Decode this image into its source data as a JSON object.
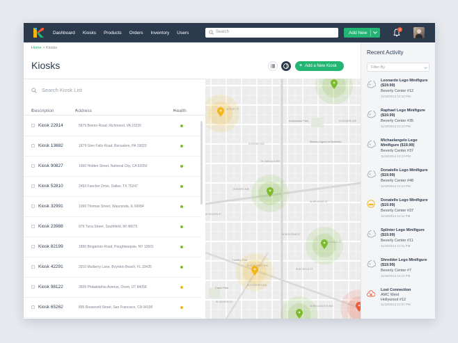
{
  "nav": {
    "items": [
      "Dashboard",
      "Kiosks",
      "Products",
      "Orders",
      "Inventory",
      "Users"
    ]
  },
  "search": {
    "placeholder": "Search"
  },
  "add_new": {
    "label": "Add New"
  },
  "notifications": {
    "count": "3"
  },
  "breadcrumb": {
    "home": "Home",
    "sep": " > ",
    "current": "Kiosks"
  },
  "page": {
    "title": "Kiosks"
  },
  "add_kiosk": {
    "label": "Add a New Kiosk",
    "icon": "+"
  },
  "kiosk_search": {
    "placeholder": "Search Kiosk List"
  },
  "table": {
    "columns": [
      "Description",
      "Address",
      "Health"
    ],
    "rows": [
      {
        "desc": "Kiosk 22914",
        "addr": "5875 Bremo Road, Richmond, VA 23226",
        "health": "#7dbb2e"
      },
      {
        "desc": "Kiosk 13682",
        "addr": "1879 Glen Falls Road, Bensalem, PA 19020",
        "health": "#7dbb2e"
      },
      {
        "desc": "Kiosk 90827",
        "addr": "1900 Holden Street, National City, CA 92050",
        "health": "#7dbb2e"
      },
      {
        "desc": "Kiosk 52810",
        "addr": "2493 Fancher Drive, Dallas, TX 75247",
        "health": "#7dbb2e"
      },
      {
        "desc": "Kiosk 32991",
        "addr": "1990 Thomas Street, Wauconda, IL 60084",
        "health": "#7dbb2e"
      },
      {
        "desc": "Kiosk 23988",
        "addr": "979 Tuna Street, Southfield, MI 48075",
        "health": "#7dbb2e"
      },
      {
        "desc": "Kiosk 82199",
        "addr": "1890 Bingamon Road, Poughkeepsie, NY 12601",
        "health": "#7dbb2e"
      },
      {
        "desc": "Kiosk 42291",
        "addr": "2910 Mulberry Lane, Boynton Beach, FL 33435",
        "health": "#7dbb2e"
      },
      {
        "desc": "Kiosk 98122",
        "addr": "3505 Philadelphia Avenue, Orem, UT 84058",
        "health": "#f2b619"
      },
      {
        "desc": "Kiosk 65262",
        "addr": "895 Roosevelt Street, San Francisco, CA 94108",
        "health": "#f2b619"
      }
    ]
  },
  "map": {
    "streets": [
      "W EDDY ST",
      "W OAKDALE AVE",
      "W BARRY AVE",
      "W MELROSE ST",
      "W NELSON ST",
      "W WOLFRAM ST",
      "W DIVERSEY AVE",
      "W GEORGE ST",
      "W WELLINGTON AVE",
      "W ALTGELD ST",
      "W SCHUBERT AVE",
      "W MONTANA ST",
      "N KILDARE AVE",
      "N KEDZIE AVE"
    ],
    "places": [
      "Blessed Agnes of Bohemia",
      "Kosciuszko Park",
      "Crane Park",
      "Country Club"
    ]
  },
  "recent": {
    "title": "Recent Activity",
    "filter": "Filter By",
    "items": [
      {
        "icon": "tag-icon",
        "title": "Leonardo Lego Minifigure ($19.99)",
        "sub": "Beverly Center #12",
        "date": "11/18/2014 12:12 PM"
      },
      {
        "icon": "tag-icon",
        "title": "Raphael Lego Minifigure ($19.99)",
        "sub": "Beverly Center #35",
        "date": "11/18/2014 12:12 PM"
      },
      {
        "icon": "tag-icon",
        "title": "Michaelangelo Lego Minifigure ($19.99)",
        "sub": "Beverly Center #37",
        "date": "11/18/2014 12:13 PM"
      },
      {
        "icon": "tag-icon",
        "title": "Donatello Lego Minifigure ($19.99)",
        "sub": "Beverly Center #48",
        "date": "11/18/2014 12:14 PM"
      },
      {
        "icon": "warning-icon",
        "title": "Donatello Lego Minifigure ($19.99)",
        "sub": "Beverly Center #37",
        "date": "11/18/2014 12:11 PM"
      },
      {
        "icon": "tag-icon",
        "title": "Splinter Lego Minifigure ($19.99)",
        "sub": "Beverly Center #11",
        "date": "11/18/2014 12:11 PM"
      },
      {
        "icon": "tag-icon",
        "title": "Shredder Lego Minifigure ($19.99)",
        "sub": "Beverly Center #7",
        "date": "11/18/2014 12:11 PM"
      },
      {
        "icon": "cloud-error-icon",
        "title": "Lost Connection",
        "sub": "AMC West Hollywood #12",
        "date": "11/18/2014 12:07 PM"
      }
    ]
  },
  "colors": {
    "accent": "#22b573",
    "topbar": "#2b3a4d",
    "alert": "#ef5a3a"
  }
}
